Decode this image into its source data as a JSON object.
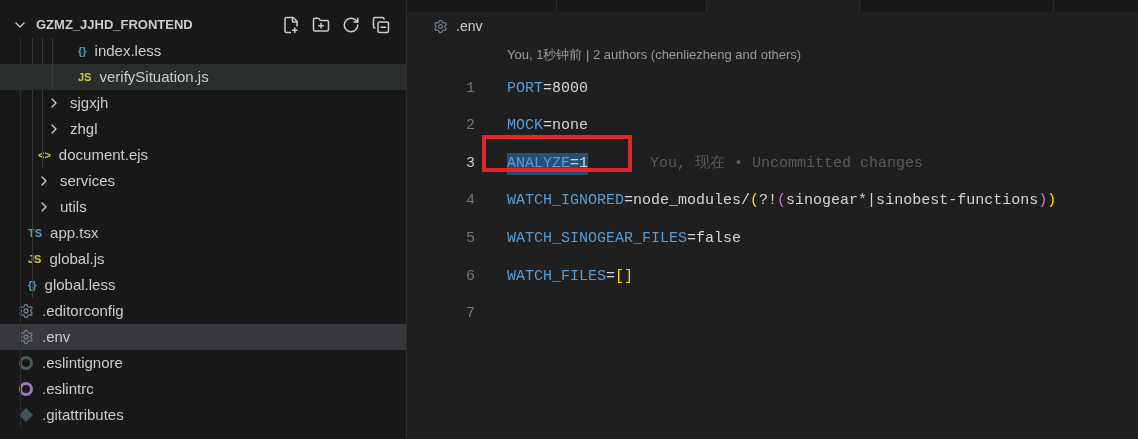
{
  "explorer": {
    "title": "GZMZ_JJHD_FRONTEND",
    "expanded": true,
    "tree": [
      {
        "children": [
          {
            "children": [
              {
                "children": [
                  {
                    "label": "index.less",
                    "kind": "less",
                    "icon": "{}",
                    "selected": false,
                    "hovered": false
                  },
                  {
                    "label": "verifySituation.js",
                    "kind": "js",
                    "icon": "JS",
                    "selected": false,
                    "hovered": true
                  }
                ]
              },
              {
                "label": "sjgxjh",
                "kind": "folder",
                "expanded": false,
                "selected": false,
                "hovered": false
              },
              {
                "label": "zhgl",
                "kind": "folder",
                "expanded": false,
                "selected": false,
                "hovered": false
              },
              {
                "label": "document.ejs",
                "kind": "ejs",
                "icon": "<>",
                "selected": false,
                "hovered": false
              }
            ]
          },
          {
            "label": "services",
            "kind": "folder",
            "expanded": false,
            "selected": false,
            "hovered": false
          },
          {
            "label": "utils",
            "kind": "folder",
            "expanded": false,
            "selected": false,
            "hovered": false
          },
          {
            "label": "app.tsx",
            "kind": "ts",
            "icon": "TS",
            "selected": false,
            "hovered": false
          },
          {
            "label": "global.js",
            "kind": "js",
            "icon": "JS",
            "selected": false,
            "hovered": false
          },
          {
            "label": "global.less",
            "kind": "less",
            "icon": "{}",
            "selected": false,
            "hovered": false
          }
        ]
      },
      {
        "label": ".editorconfig",
        "kind": "config",
        "selected": false,
        "hovered": false
      },
      {
        "label": ".env",
        "kind": "config",
        "selected": true,
        "hovered": false
      },
      {
        "label": ".eslintignore",
        "kind": "eslintignore",
        "selected": false,
        "hovered": false
      },
      {
        "label": ".eslintrc",
        "kind": "eslintrc",
        "selected": false,
        "hovered": false
      },
      {
        "label": ".gitattributes",
        "kind": "git",
        "selected": false,
        "hovered": false
      }
    ]
  },
  "editor": {
    "breadcrumb": ".env",
    "codelens": "You, 1秒钟前 | 2 authors (chenliezheng and others)",
    "lines": [
      {
        "number": "1",
        "active": false,
        "boxed": false,
        "tokens": [
          {
            "text": "PORT",
            "kind": "key",
            "selected": false
          },
          {
            "text": "=8000",
            "kind": "plain",
            "selected": false
          }
        ]
      },
      {
        "number": "2",
        "active": false,
        "boxed": false,
        "tokens": [
          {
            "text": "MOCK",
            "kind": "key",
            "selected": false
          },
          {
            "text": "=none",
            "kind": "plain",
            "selected": false
          }
        ]
      },
      {
        "number": "3",
        "active": true,
        "boxed": true,
        "blame": "You, 现在 • Uncommitted changes",
        "tokens": [
          {
            "text": "ANALYZE",
            "kind": "key",
            "selected": true
          },
          {
            "text": "=1",
            "kind": "plain",
            "selected": true
          }
        ]
      },
      {
        "number": "4",
        "active": false,
        "boxed": false,
        "tokens": [
          {
            "text": "WATCH_IGNORED",
            "kind": "key",
            "selected": false
          },
          {
            "text": "=node_modules/",
            "kind": "plain",
            "selected": false
          },
          {
            "text": "(",
            "kind": "paren1",
            "selected": false
          },
          {
            "text": "?!",
            "kind": "plain",
            "selected": false
          },
          {
            "text": "(",
            "kind": "paren2",
            "selected": false
          },
          {
            "text": "sinogear*|sinobest-functions",
            "kind": "plain",
            "selected": false
          },
          {
            "text": ")",
            "kind": "paren2",
            "selected": false
          },
          {
            "text": ")",
            "kind": "paren1",
            "selected": false
          }
        ]
      },
      {
        "number": "5",
        "active": false,
        "boxed": false,
        "tokens": [
          {
            "text": "WATCH_SINOGEAR_FILES",
            "kind": "key",
            "selected": false
          },
          {
            "text": "=false",
            "kind": "plain",
            "selected": false
          }
        ]
      },
      {
        "number": "6",
        "active": false,
        "boxed": false,
        "tokens": [
          {
            "text": "WATCH_FILES",
            "kind": "key",
            "selected": false
          },
          {
            "text": "=",
            "kind": "plain",
            "selected": false
          },
          {
            "text": "[]",
            "kind": "paren1",
            "selected": false
          }
        ]
      },
      {
        "number": "7",
        "active": false,
        "boxed": false
      }
    ]
  }
}
